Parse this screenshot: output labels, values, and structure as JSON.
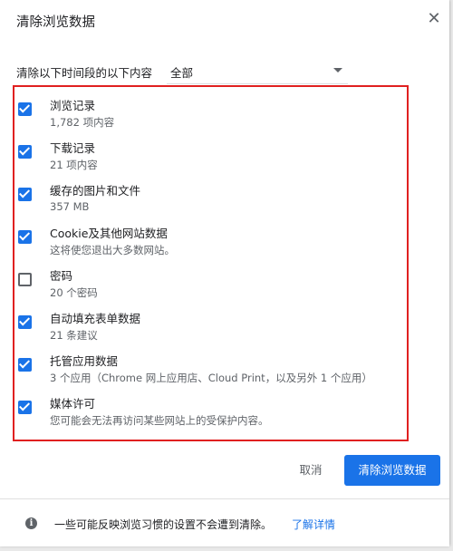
{
  "dialog": {
    "title": "清除浏览数据",
    "close_symbol": "✕"
  },
  "time_range": {
    "label": "清除以下时间段的以下内容",
    "selected": "全部"
  },
  "items": [
    {
      "label": "浏览记录",
      "desc": "1,782 项内容",
      "checked": true
    },
    {
      "label": "下载记录",
      "desc": "21 项内容",
      "checked": true
    },
    {
      "label": "缓存的图片和文件",
      "desc": "357 MB",
      "checked": true
    },
    {
      "label": "Cookie及其他网站数据",
      "desc": "这将使您退出大多数网站。",
      "checked": true
    },
    {
      "label": "密码",
      "desc": "20 个密码",
      "checked": false
    },
    {
      "label": "自动填充表单数据",
      "desc": "21 条建议",
      "checked": true
    },
    {
      "label": "托管应用数据",
      "desc": "3 个应用（Chrome 网上应用店、Cloud Print，以及另外 1 个应用）",
      "checked": true
    },
    {
      "label": "媒体许可",
      "desc": "您可能会无法再访问某些网站上的受保护内容。",
      "checked": true
    }
  ],
  "buttons": {
    "cancel": "取消",
    "clear": "清除浏览数据"
  },
  "footer": {
    "info_symbol": "i",
    "text": "一些可能反映浏览习惯的设置不会遭到清除。",
    "link": "了解详情"
  },
  "colors": {
    "accent": "#1a73e8",
    "highlight_border": "#e02020"
  }
}
